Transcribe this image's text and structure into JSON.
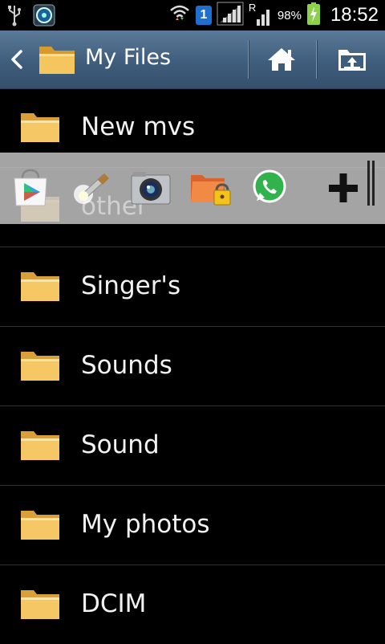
{
  "status_bar": {
    "time": "18:52",
    "battery_percent": "98%",
    "sim_badge": "1",
    "roaming_indicator": "R",
    "icons": [
      "usb-icon",
      "notification-app-icon",
      "wifi-icon",
      "sim-badge",
      "signal-icon",
      "roaming-signal-icon",
      "battery-charging-icon"
    ]
  },
  "action_bar": {
    "title": "My Files",
    "icons": [
      "back-icon",
      "folder-icon",
      "home-icon",
      "up-folder-icon"
    ],
    "color": "#4a6b8c"
  },
  "folders": [
    {
      "name": "New mvs"
    },
    {
      "name": "other"
    },
    {
      "name": "Singer's"
    },
    {
      "name": "Sounds"
    },
    {
      "name": "Sound"
    },
    {
      "name": "My photos"
    },
    {
      "name": "DCIM"
    }
  ],
  "quick_launch_bar": {
    "apps": [
      "play-store-icon",
      "flashlight-icon",
      "camera-icon",
      "folder-lock-icon",
      "whatsapp-icon",
      "add-icon"
    ]
  },
  "colors": {
    "folder": "#f2c35a",
    "background": "#000000",
    "overlay": "#c8c8c8",
    "whatsapp": "#2fb34a"
  }
}
